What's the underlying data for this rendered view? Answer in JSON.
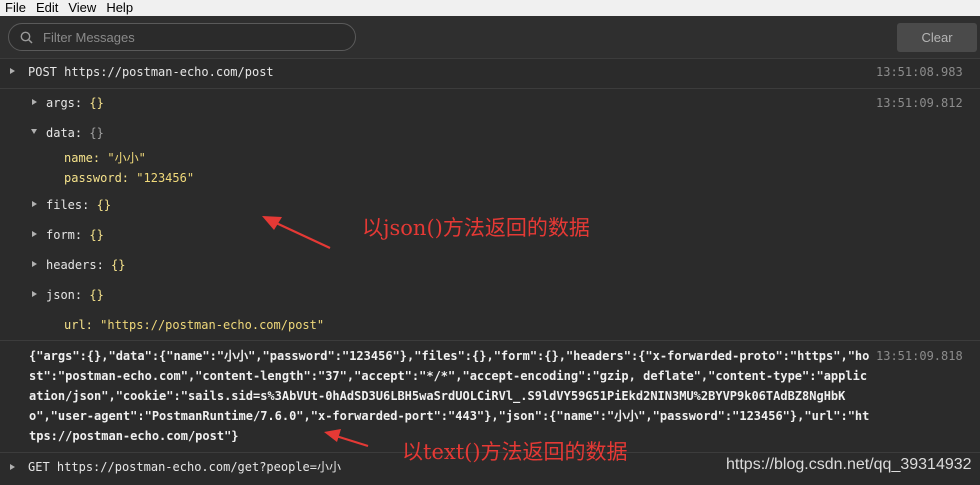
{
  "menu": [
    "File",
    "Edit",
    "View",
    "Help"
  ],
  "filter": {
    "placeholder": "Filter Messages"
  },
  "clear_label": "Clear",
  "request_post": {
    "method": "POST",
    "url": "https://postman-echo.com/post",
    "timestamp": "13:51:08.983"
  },
  "json_response": {
    "timestamp": "13:51:09.812",
    "args_key": "args:",
    "args_val": "{}",
    "data_key": "data:",
    "data_val": "{}",
    "name_key": "name:",
    "name_val": "\"小小\"",
    "password_key": "password:",
    "password_val": "\"123456\"",
    "files_key": "files:",
    "files_val": "{}",
    "form_key": "form:",
    "form_val": "{}",
    "headers_key": "headers:",
    "headers_val": "{}",
    "json_key": "json:",
    "json_val": "{}",
    "url_key": "url:",
    "url_val": "\"https://postman-echo.com/post\""
  },
  "text_response": {
    "timestamp": "13:51:09.818",
    "lines": [
      "{\"args\":{},\"data\":{\"name\":\"小小\",\"password\":\"123456\"},\"files\":{},\"form\":{},\"headers\":{\"x-forwarded-proto\":\"https\",\"ho",
      "st\":\"postman-echo.com\",\"content-length\":\"37\",\"accept\":\"*/*\",\"accept-encoding\":\"gzip, deflate\",\"content-type\":\"applic",
      "ation/json\",\"cookie\":\"sails.sid=s%3AbVUt-0hAdSD3U6LBH5waSrdUOLCiRVl_.S9ldVY59G51PiEkd2NIN3MU%2BYVP9k06TAdBZ8NgHbK",
      "o\",\"user-agent\":\"PostmanRuntime/7.6.0\",\"x-forwarded-port\":\"443\"},\"json\":{\"name\":\"小小\",\"password\":\"123456\"},\"url\":\"ht",
      "tps://postman-echo.com/post\"}"
    ]
  },
  "request_get": {
    "method": "GET",
    "url": "https://postman-echo.com/get?people=小小"
  },
  "annotations": {
    "json": "以json()方法返回的数据",
    "text": "以text()方法返回的数据",
    "color": "#e53935"
  },
  "watermark": "https://blog.csdn.net/qq_39314932"
}
